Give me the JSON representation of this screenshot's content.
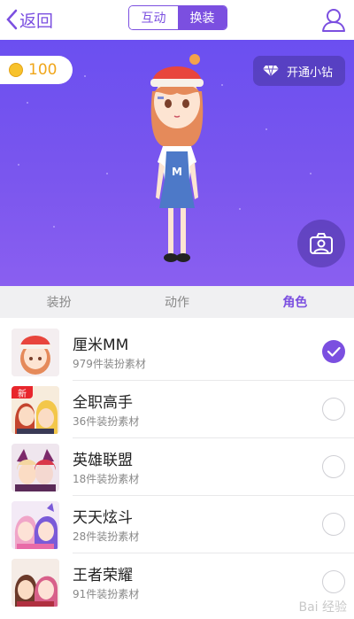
{
  "header": {
    "back_label": "返回",
    "segments": [
      {
        "label": "互动",
        "active": false
      },
      {
        "label": "换装",
        "active": true
      }
    ]
  },
  "hero": {
    "coins": "100",
    "vip_label": "开通小钻"
  },
  "tabs": [
    {
      "label": "装扮",
      "active": false
    },
    {
      "label": "动作",
      "active": false
    },
    {
      "label": "角色",
      "active": true
    }
  ],
  "roles": [
    {
      "title": "厘米MM",
      "subtitle": "979件装扮素材",
      "selected": true,
      "badge": ""
    },
    {
      "title": "全职高手",
      "subtitle": "36件装扮素材",
      "selected": false,
      "badge": "新"
    },
    {
      "title": "英雄联盟",
      "subtitle": "18件装扮素材",
      "selected": false,
      "badge": ""
    },
    {
      "title": "天天炫斗",
      "subtitle": "28件装扮素材",
      "selected": false,
      "badge": ""
    },
    {
      "title": "王者荣耀",
      "subtitle": "91件装扮素材",
      "selected": false,
      "badge": ""
    }
  ],
  "watermark": "Bai 经验",
  "colors": {
    "accent": "#7b4fe0",
    "coin": "#f0a61a",
    "new_badge": "#e8262c"
  }
}
